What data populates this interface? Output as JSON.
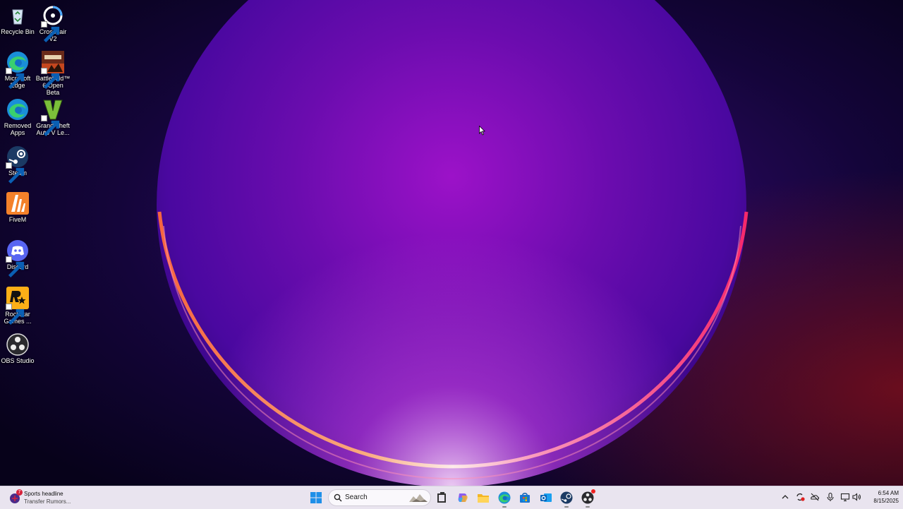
{
  "desktop": {
    "icons": [
      {
        "label": "Recycle Bin",
        "icon": "recycle-bin-icon"
      },
      {
        "label": "Crosshair V2",
        "icon": "crosshair-icon"
      },
      {
        "label": "Microsoft Edge",
        "icon": "edge-icon"
      },
      {
        "label": "Battlefield™ 6 Open Beta",
        "icon": "battlefield-icon"
      },
      {
        "label": "Removed Apps",
        "icon": "edge-icon"
      },
      {
        "label": "Grand Theft Auto V Le...",
        "icon": "gta-v-icon"
      },
      {
        "label": "Steam",
        "icon": "steam-icon"
      },
      {
        "label": "FiveM",
        "icon": "fivem-icon"
      },
      {
        "label": "Discord",
        "icon": "discord-icon"
      },
      {
        "label": "Rockstar Games ...",
        "icon": "rockstar-icon"
      },
      {
        "label": "OBS Studio",
        "icon": "obs-icon"
      }
    ]
  },
  "taskbar": {
    "widget": {
      "badge": "7",
      "line1": "Sports headline",
      "line2": "Transfer Rumors..."
    },
    "search_placeholder": "Search",
    "pinned": [
      "start-icon",
      "task-view-icon",
      "copilot-icon",
      "file-explorer-icon",
      "edge-icon",
      "store-icon",
      "outlook-icon",
      "steam-icon",
      "obs-icon"
    ],
    "tray": [
      "chevron-up-icon",
      "sync-icon",
      "onedrive-icon",
      "microphone-icon",
      "display-icon",
      "volume-icon"
    ],
    "time": "6:54 AM",
    "date": "8/15/2025"
  },
  "colors": {
    "taskbar": "#e9e4ef",
    "desktop_bg": "#0a0320",
    "accent": "#0078d4"
  }
}
